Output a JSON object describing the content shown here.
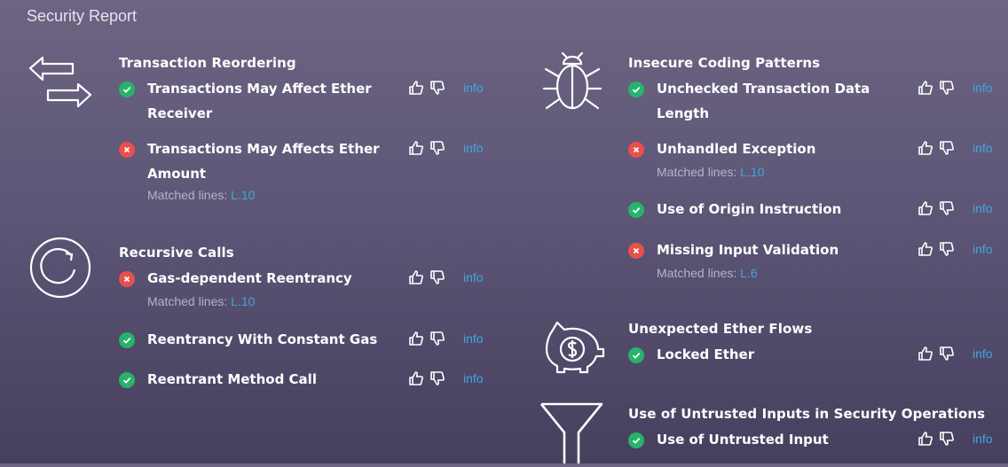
{
  "header": {
    "title": "Security Report"
  },
  "categories": {
    "reordering": {
      "title": "Transaction Reordering",
      "icon": "arrows-exchange-icon"
    },
    "recursive": {
      "title": "Recursive Calls",
      "icon": "circular-arrow-icon"
    },
    "insecure": {
      "title": "Insecure Coding Patterns",
      "icon": "bug-icon"
    },
    "ether_flows": {
      "title": "Unexpected Ether Flows",
      "icon": "piggy-bank-icon"
    },
    "untrusted": {
      "title": "Use of Untrusted Inputs in Security Operations",
      "icon": "funnel-icon"
    }
  },
  "items": {
    "tx_receiver": {
      "label_1": "Transactions May Affect Ether",
      "label_2": "Receiver",
      "status": "pass"
    },
    "tx_amount": {
      "label_1": "Transactions May Affects Ether",
      "label_2": "Amount",
      "status": "fail",
      "matched_prefix": "Matched lines: ",
      "matched_line": "L.10"
    },
    "gas_reentrancy": {
      "label": "Gas-dependent Reentrancy",
      "status": "fail",
      "matched_prefix": "Matched lines: ",
      "matched_line": "L.10"
    },
    "reentrancy_const": {
      "label": "Reentrancy With Constant Gas",
      "status": "pass"
    },
    "reentrant_call": {
      "label": "Reentrant Method Call",
      "status": "pass"
    },
    "unchecked_len": {
      "label_1": "Unchecked Transaction Data",
      "label_2": "Length",
      "status": "pass"
    },
    "unhandled_exc": {
      "label": "Unhandled Exception",
      "status": "fail",
      "matched_prefix": "Matched lines: ",
      "matched_line": "L.10"
    },
    "origin_instr": {
      "label": "Use of Origin Instruction",
      "status": "pass"
    },
    "missing_input": {
      "label": "Missing Input Validation",
      "status": "fail",
      "matched_prefix": "Matched lines: ",
      "matched_line": "L.6"
    },
    "locked_ether": {
      "label": "Locked Ether",
      "status": "pass"
    },
    "untrusted_input": {
      "label": "Use of Untrusted Input",
      "status": "pass"
    }
  },
  "actions": {
    "info_label": "info",
    "thumbs_up_icon": "thumbs-up-icon",
    "thumbs_down_icon": "thumbs-down-icon"
  },
  "colors": {
    "pass": "#27b36b",
    "fail": "#e8504d",
    "link": "#3fa6e0"
  }
}
